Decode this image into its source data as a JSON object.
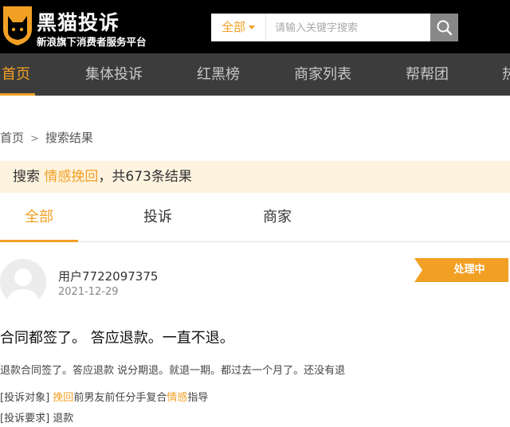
{
  "header": {
    "logo_title": "黑猫投诉",
    "logo_subtitle": "新浪旗下消费者服务平台",
    "search": {
      "category": "全部",
      "placeholder": "请输入关键字搜索",
      "value": ""
    }
  },
  "nav": {
    "items": [
      {
        "label": "首页",
        "active": true
      },
      {
        "label": "集体投诉",
        "active": false
      },
      {
        "label": "红黑榜",
        "active": false
      },
      {
        "label": "商家列表",
        "active": false
      },
      {
        "label": "帮帮团",
        "active": false
      },
      {
        "label": "热",
        "active": false
      }
    ]
  },
  "breadcrumb": {
    "home": "首页",
    "separator": ">",
    "current": "搜索结果"
  },
  "results": {
    "prefix": "搜索",
    "keyword": "情感挽回",
    "suffix": "，共673条结果"
  },
  "tabs": [
    {
      "label": "全部",
      "active": true
    },
    {
      "label": "投诉",
      "active": false
    },
    {
      "label": "商家",
      "active": false
    }
  ],
  "complaint": {
    "user": "用户7722097375",
    "date": "2021-12-29",
    "status": "处理中",
    "title": "合同都签了。 答应退款。一直不退。",
    "description": "退款合同签了。答应退款 说分期退。就退一期。都过去一个月了。还没有退",
    "target_label": "[投诉对象]",
    "target_hl1": "挽回",
    "target_mid": "前男友前任分手复合",
    "target_hl2": "情感",
    "target_end": "指导",
    "demand_label": "[投诉要求]",
    "demand_value": "退款"
  },
  "colors": {
    "accent": "#f2a024",
    "header_bg": "#000000",
    "nav_bg": "#3c3c3c",
    "result_bar_bg": "#fef3df"
  },
  "icons": {
    "logo": "black-cat-icon",
    "search": "search-icon",
    "avatar": "default-avatar-icon",
    "dropdown": "caret-down-icon"
  }
}
